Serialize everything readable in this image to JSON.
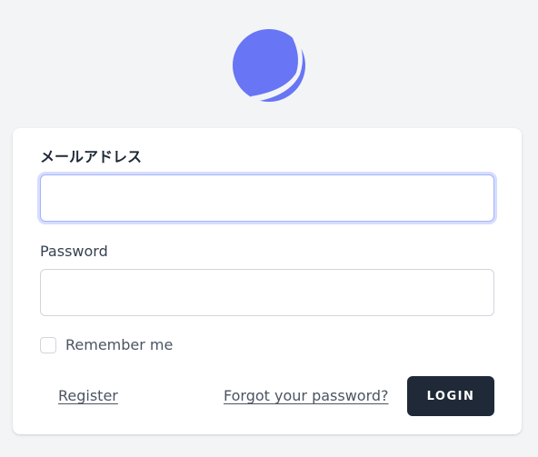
{
  "logo": {
    "icon": "app-logo-icon",
    "color": "#6875f5"
  },
  "form": {
    "email_label": "メールアドレス",
    "email_value": "",
    "password_label": "Password",
    "password_value": "",
    "remember_label": "Remember me",
    "remember_checked": false,
    "register_label": "Register",
    "forgot_label": "Forgot your password?",
    "login_label": "LOGIN"
  },
  "colors": {
    "page_bg": "#f3f4f6",
    "card_bg": "#ffffff",
    "button_bg": "#1f2937",
    "focus_ring": "#a5b4fc"
  }
}
